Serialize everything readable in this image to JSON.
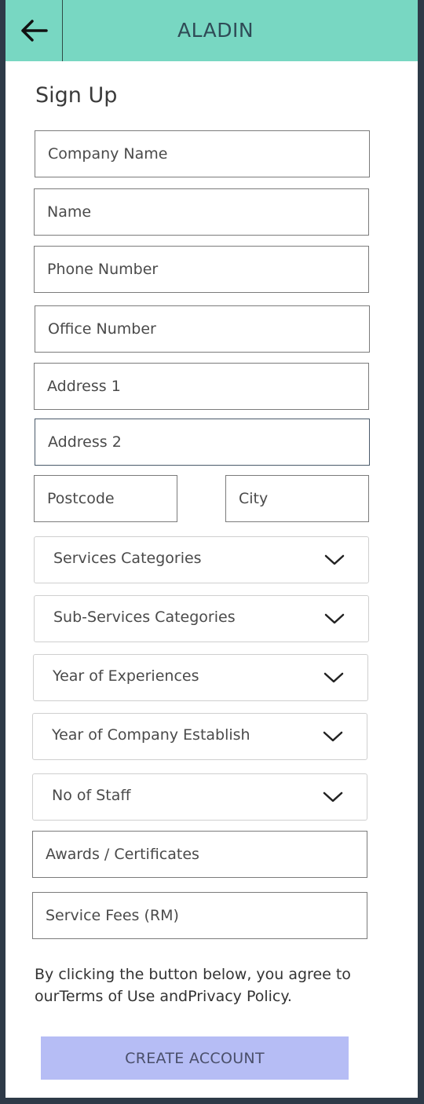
{
  "header": {
    "back_icon": "arrow-left-icon",
    "title": "ALADIN",
    "background": "#78d7c2"
  },
  "form": {
    "heading": "Sign Up",
    "company_name": "Company Name",
    "name": "Name",
    "phone_number": "Phone Number",
    "office_number": "Office Number",
    "address1": "Address 1",
    "address2": "Address 2",
    "postcode": "Postcode",
    "city": "City",
    "services_categories": "Services Categories",
    "sub_services_categories": "Sub-Services Categories",
    "year_of_experiences": "Year of Experiences",
    "year_of_company_establish": "Year of Company Establish",
    "no_of_staff": "No of Staff",
    "awards_certificates": "Awards / Certificates",
    "service_fees": "Service Fees (RM)",
    "dropdown_icon": "chevron-down-icon"
  },
  "terms": {
    "prefix": "By clicking the button below, you agree to our",
    "terms_link": "Terms of Use",
    "middle": " and",
    "privacy_link": "Privacy Policy",
    "suffix": "."
  },
  "create_account": {
    "label": "CREATE ACCOUNT",
    "background": "#b6bdf5"
  }
}
